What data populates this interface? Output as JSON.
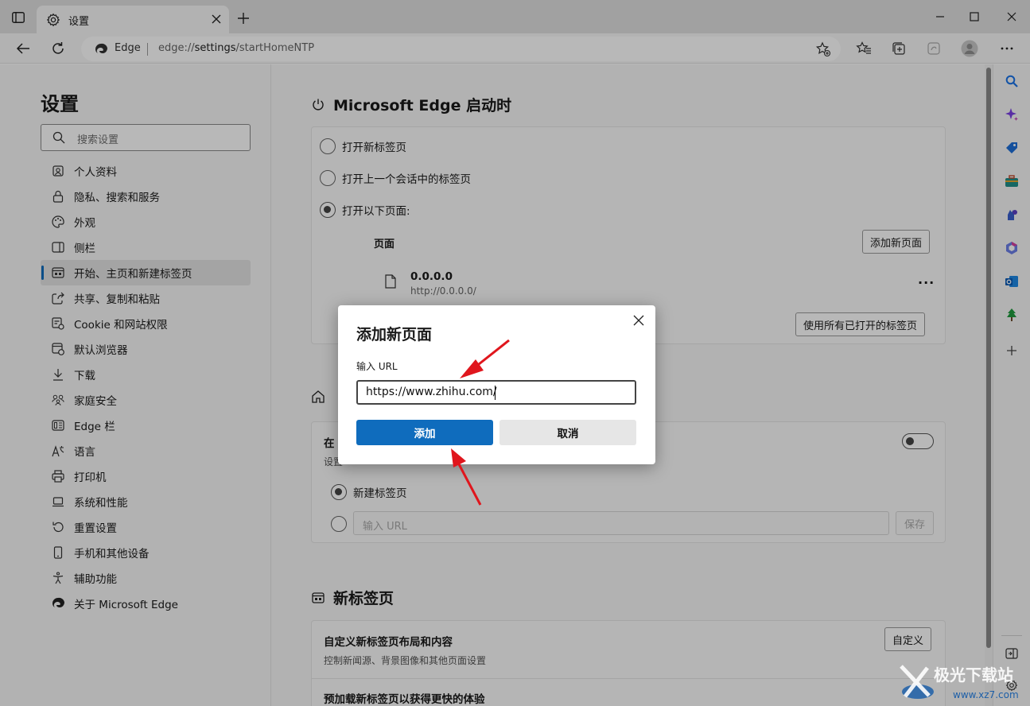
{
  "browser": {
    "tab_title": "设置",
    "address": {
      "site_name": "Edge",
      "url_prefix": "edge://",
      "url_host": "settings",
      "url_path": "/startHomeNTP"
    }
  },
  "nav": {
    "title": "设置",
    "search_placeholder": "搜索设置",
    "items": [
      {
        "label": "个人资料",
        "icon": "profile-icon"
      },
      {
        "label": "隐私、搜索和服务",
        "icon": "lock-icon"
      },
      {
        "label": "外观",
        "icon": "palette-icon"
      },
      {
        "label": "侧栏",
        "icon": "sidebar-icon"
      },
      {
        "label": "开始、主页和新建标签页",
        "icon": "home-tab-icon",
        "active": true
      },
      {
        "label": "共享、复制和粘贴",
        "icon": "share-icon"
      },
      {
        "label": "Cookie 和网站权限",
        "icon": "cookie-icon"
      },
      {
        "label": "默认浏览器",
        "icon": "browser-icon"
      },
      {
        "label": "下载",
        "icon": "download-icon"
      },
      {
        "label": "家庭安全",
        "icon": "family-icon"
      },
      {
        "label": "Edge 栏",
        "icon": "edge-bar-icon"
      },
      {
        "label": "语言",
        "icon": "language-icon"
      },
      {
        "label": "打印机",
        "icon": "printer-icon"
      },
      {
        "label": "系统和性能",
        "icon": "laptop-icon"
      },
      {
        "label": "重置设置",
        "icon": "reset-icon"
      },
      {
        "label": "手机和其他设备",
        "icon": "phone-icon"
      },
      {
        "label": "辅助功能",
        "icon": "accessibility-icon"
      },
      {
        "label": "关于 Microsoft Edge",
        "icon": "edge-logo-icon"
      }
    ]
  },
  "startup": {
    "title": "Microsoft Edge 启动时",
    "option_new_tab": "打开新标签页",
    "option_previous": "打开上一个会话中的标签页",
    "option_pages": "打开以下页面:",
    "pages_header": "页面",
    "add_page_button": "添加新页面",
    "page_name": "0.0.0.0",
    "page_url": "http://0.0.0.0/",
    "use_open_tabs_button": "使用所有已打开的标签页"
  },
  "home_section": {
    "row_title_visible": "在",
    "row_sub_visible": "设置",
    "option_new_tab": "新建标签页",
    "url_placeholder": "输入 URL",
    "save_button": "保存"
  },
  "ntp_section": {
    "title": "新标签页",
    "custom_title": "自定义新标签页布局和内容",
    "custom_sub": "控制新闻源、背景图像和其他页面设置",
    "custom_button": "自定义",
    "preload_title": "预加载新标签页以获得更快的体验"
  },
  "dialog": {
    "title": "添加新页面",
    "label": "输入 URL",
    "input_value": "https://www.zhihu.com/",
    "add_button": "添加",
    "cancel_button": "取消"
  },
  "colors": {
    "accent": "#0f6cbd",
    "arrow": "#e0161d"
  },
  "watermark_text": "极光下载站",
  "watermark_url": "www.xz7.com"
}
